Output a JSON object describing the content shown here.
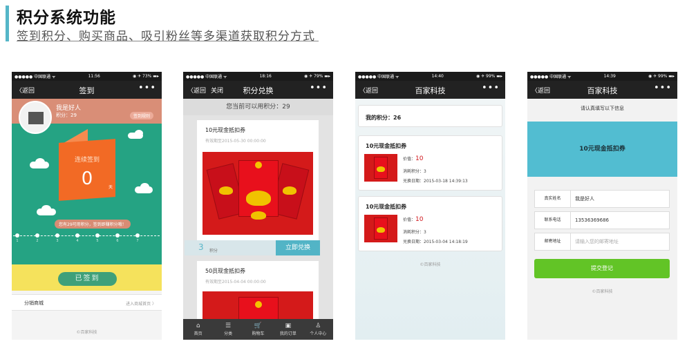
{
  "header": {
    "title": "积分系统功能",
    "subtitle": "签到积分、购买商品、吸引粉丝等多渠道获取积分方式"
  },
  "colors": {
    "accent": "#55b6c8",
    "signin_green": "#25a383",
    "profile_salmon": "#d98e77",
    "card_orange": "#f26a25",
    "strip_yellow": "#f5e25c",
    "redeem_blue": "#52b4c6",
    "submit_green": "#62c426",
    "value_red": "#d0141a"
  },
  "phone1": {
    "status": {
      "carrier": "●●●●● 中国联通 ᯤ",
      "time": "11:56",
      "battery": "◉ ✈ 73% ▬▸"
    },
    "nav": {
      "back": "返回",
      "title": "签到",
      "more": "•••"
    },
    "profile": {
      "name": "我是好人",
      "points": "积分：29",
      "rule": "签到规则"
    },
    "streak_label": "连续签到",
    "streak_value": "0",
    "streak_unit": "天",
    "message": "您有29可用积分，签到即赚积分哦！",
    "day_numbers": [
      "1",
      "2",
      "3",
      "4",
      "5",
      "6",
      "7"
    ],
    "signed_button": "已签到",
    "list": {
      "left": "分销商城",
      "right": "进入商城首页 〉"
    },
    "footer": "©百家科技"
  },
  "phone2": {
    "status": {
      "carrier": "●●●●● 中国联通 ᯤ",
      "time": "18:16",
      "battery": "◉ ✈ 79% ▬▸"
    },
    "nav": {
      "back": "返回",
      "close": "关闭",
      "title": "积分兑换",
      "more": "•••"
    },
    "available_points": "您当前可以用积分：29",
    "coupons": [
      {
        "title": "10元现金抵扣券",
        "valid": "有效期至2015-05-30 00:00:00",
        "cost": "3",
        "cost_unit": "积分",
        "action": "立即兑换"
      },
      {
        "title": "50员现金抵扣券",
        "valid": "有效期至2015-04-04 00:00:00"
      }
    ],
    "tabs": [
      {
        "icon": "⌂",
        "label": "首页"
      },
      {
        "icon": "☰",
        "label": "分类"
      },
      {
        "icon": "🛒",
        "label": "购物车"
      },
      {
        "icon": "▣",
        "label": "我的订单"
      },
      {
        "icon": "♙",
        "label": "个人中心"
      }
    ]
  },
  "phone3": {
    "status": {
      "carrier": "●●●●● 中国联通 ᯤ",
      "time": "14:40",
      "battery": "◉ ✈ 99% ▬▸"
    },
    "nav": {
      "back": "返回",
      "title": "百家科技",
      "more": "•••"
    },
    "my_points": "我的积分：26",
    "records": [
      {
        "title": "10元现金抵扣券",
        "value_label": "价值：",
        "value": "10",
        "cost": "消耗积分：3",
        "date": "兑换日期：2015-03-18 14:39:13"
      },
      {
        "title": "10元现金抵扣券",
        "value_label": "价值：",
        "value": "10",
        "cost": "消耗积分：3",
        "date": "兑换日期：2015-03-04 14:18:19"
      }
    ],
    "footer": "©百家科技"
  },
  "phone4": {
    "status": {
      "carrier": "●●●●● 中国联通 ᯤ",
      "time": "14:39",
      "battery": "◉ ✈ 99% ▬▸"
    },
    "nav": {
      "back": "返回",
      "title": "百家科技",
      "more": "•••"
    },
    "hint": "请认真填写以下信息",
    "coupon_name": "10元现金抵扣券",
    "fields": [
      {
        "label": "真实姓名",
        "value": "我是好人"
      },
      {
        "label": "联系电话",
        "value": "13536369686"
      },
      {
        "label": "邮寄地址",
        "placeholder": "请输入您的邮寄地址"
      }
    ],
    "submit": "提交登记",
    "footer": "©百家科技"
  }
}
